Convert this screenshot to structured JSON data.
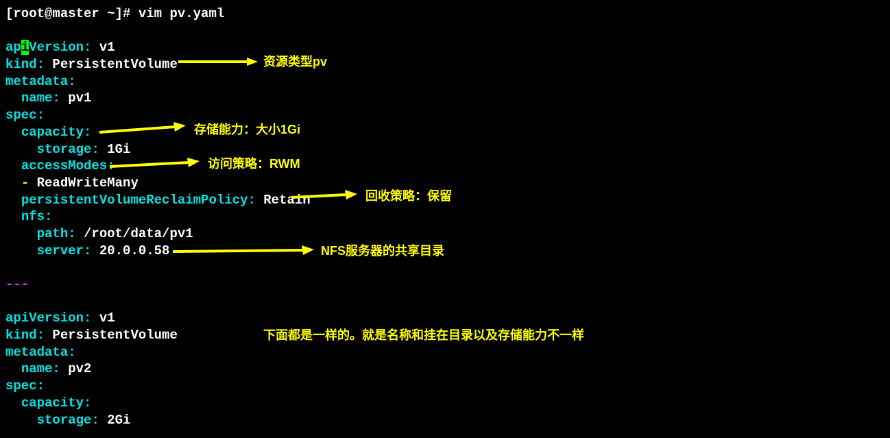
{
  "prompt": "[root@master ~]# vim pv.yaml",
  "yaml1": {
    "apiVersion_key": "apiVersion",
    "apiVersion_val": "v1",
    "kind_key": "kind",
    "kind_val": "PersistentVolume",
    "metadata_key": "metadata",
    "name_key": "name",
    "name_val": "pv1",
    "spec_key": "spec",
    "capacity_key": "capacity",
    "storage_key": "storage",
    "storage_val": "1Gi",
    "accessModes_key": "accessModes",
    "accessModes_val": "ReadWriteMany",
    "reclaimPolicy_key": "persistentVolumeReclaimPolicy",
    "reclaimPolicy_val": "Retain",
    "nfs_key": "nfs",
    "path_key": "path",
    "path_val": "/root/data/pv1",
    "server_key": "server",
    "server_val": "20.0.0.58"
  },
  "separator": "---",
  "yaml2": {
    "apiVersion_key": "apiVersion",
    "apiVersion_val": "v1",
    "kind_key": "kind",
    "kind_val": "PersistentVolume",
    "metadata_key": "metadata",
    "name_key": "name",
    "name_val": "pv2",
    "spec_key": "spec",
    "capacity_key": "capacity",
    "storage_key": "storage",
    "storage_val": "2Gi"
  },
  "annotations": {
    "kind": "资源类型pv",
    "capacity": "存储能力：大小1Gi",
    "accessModes": "访问策略：RWM",
    "reclaimPolicy": "回收策略：保留",
    "server": "NFS服务器的共享目录",
    "section2": "下面都是一样的。就是名称和挂在目录以及存储能力不一样"
  }
}
